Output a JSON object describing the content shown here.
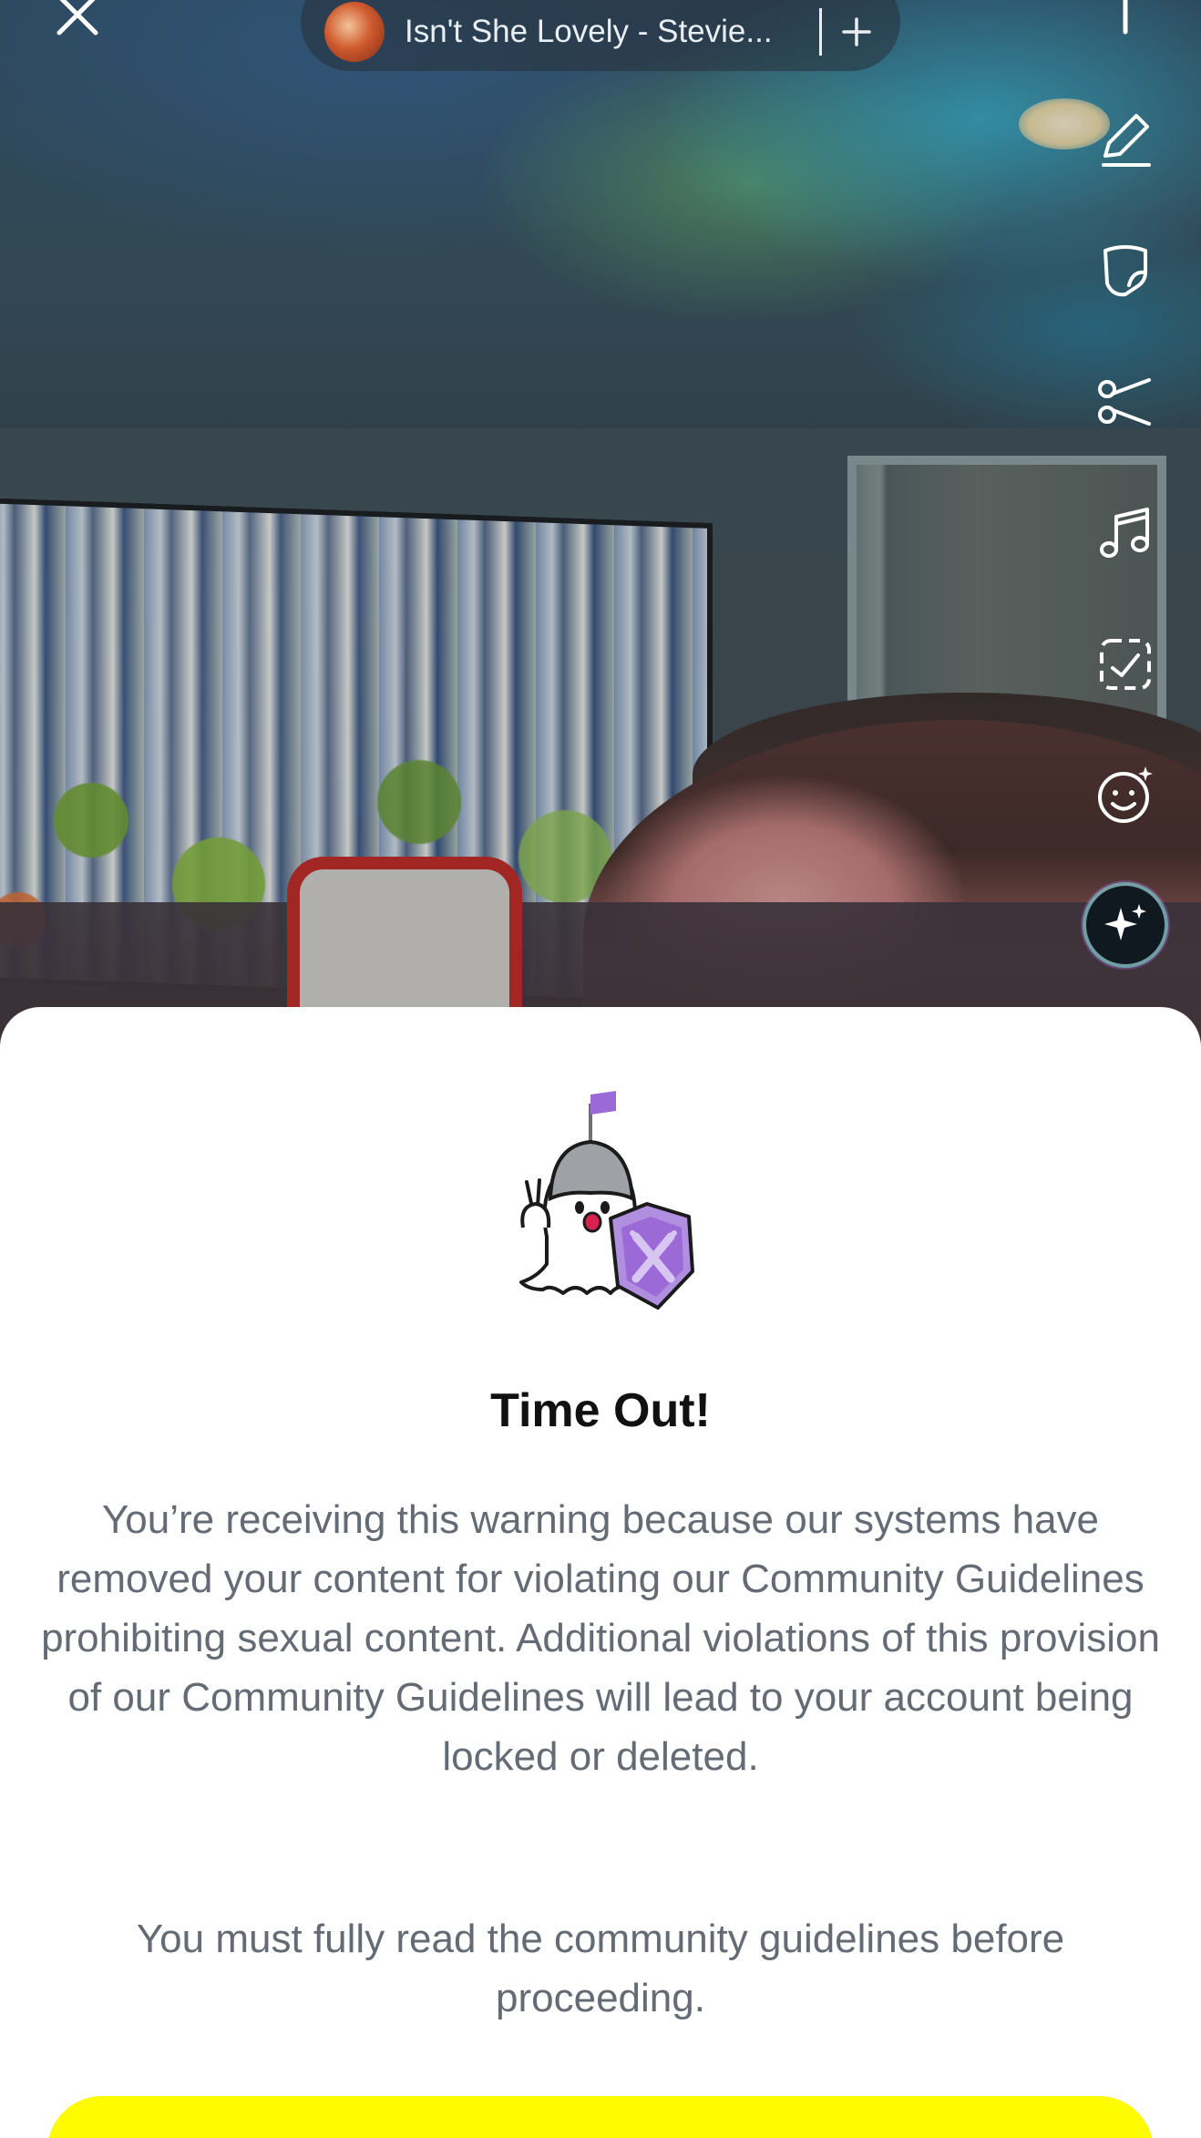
{
  "music": {
    "track_title": "Isn't She Lovely - Stevie...",
    "add_icon": "plus-icon",
    "album_icon": "album-art"
  },
  "toolbar": {
    "items": [
      {
        "icon": "text-icon"
      },
      {
        "icon": "pencil-icon"
      },
      {
        "icon": "sticker-icon"
      },
      {
        "icon": "scissors-icon"
      },
      {
        "icon": "music-note-icon"
      },
      {
        "icon": "scan-icon"
      },
      {
        "icon": "lens-smile-icon"
      },
      {
        "icon": "ai-sparkle-icon"
      }
    ]
  },
  "sheet": {
    "title": "Time Out!",
    "body": "You’re receiving this warning because our systems have removed your content for violating our Community Guidelines prohibiting sexual content. Additional violations of this provision of our Community Guidelines will lead to your account being locked or deleted.",
    "body2": "You must fully read the community guidelines before proceeding."
  },
  "colors": {
    "cta_yellow": "#fffc00",
    "body_text": "#646b74",
    "title_text": "#111111",
    "mascot_purple": "#9b6ad6"
  }
}
